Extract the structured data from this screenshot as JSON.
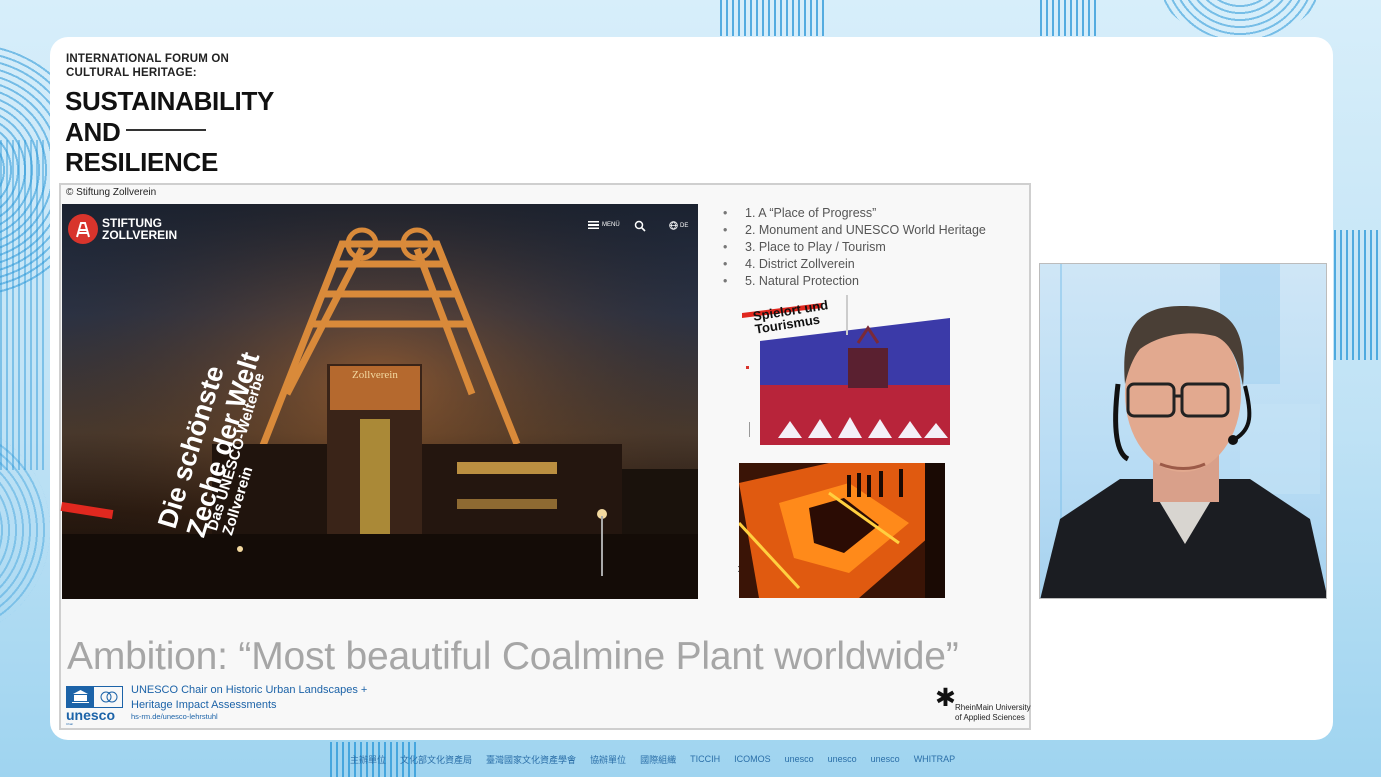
{
  "forum": {
    "small_title": "INTERNATIONAL FORUM ON CULTURAL HERITAGE:",
    "line1": "SUSTAINABILITY",
    "line2": "AND",
    "line3": "RESILIENCE"
  },
  "slide": {
    "credit": "© Stiftung Zollverein",
    "website": {
      "brand": "STIFTUNG ZOLLVEREIN",
      "menu_label": "MENÜ",
      "lang_label": "DE",
      "headline_1": "Die schönste",
      "headline_2": "Zeche der Welt",
      "subline_1": "Das UNESCO-Welterbe",
      "subline_2": "Zollverein",
      "sign": "Zollverein"
    },
    "bullets": [
      "1. A “Place of Progress”",
      "2. Monument and UNESCO World Heritage",
      "3. Place to Play / Tourism",
      "4. District Zollverein",
      "5. Natural Protection"
    ],
    "tourism_title_1": "Spielort und",
    "tourism_title_2": "Tourismus",
    "ambition": "Ambition: “Most beautiful Coalmine Plant worldwide”",
    "unesco": {
      "word": "unesco",
      "chair_tag": "Chair",
      "text_1": "UNESCO Chair on Historic Urban Landscapes +",
      "text_2": "Heritage Impact Assessments",
      "url": "hs-rm.de/unesco-lehrstuhl"
    },
    "university": {
      "line1": "RheinMain University",
      "line2": "of Applied Sciences"
    }
  },
  "footer": {
    "logos": [
      "主辦單位",
      "文化部文化資產局",
      "臺灣國家文化資產學會",
      "協辦單位",
      "國際組織",
      "TICCIH",
      "ICOMOS",
      "unesco",
      "unesco",
      "unesco",
      "WHITRAP"
    ]
  },
  "colors": {
    "accent_red": "#e0281f",
    "unesco_blue": "#1c63a8",
    "background_blue": "#2896d7"
  }
}
